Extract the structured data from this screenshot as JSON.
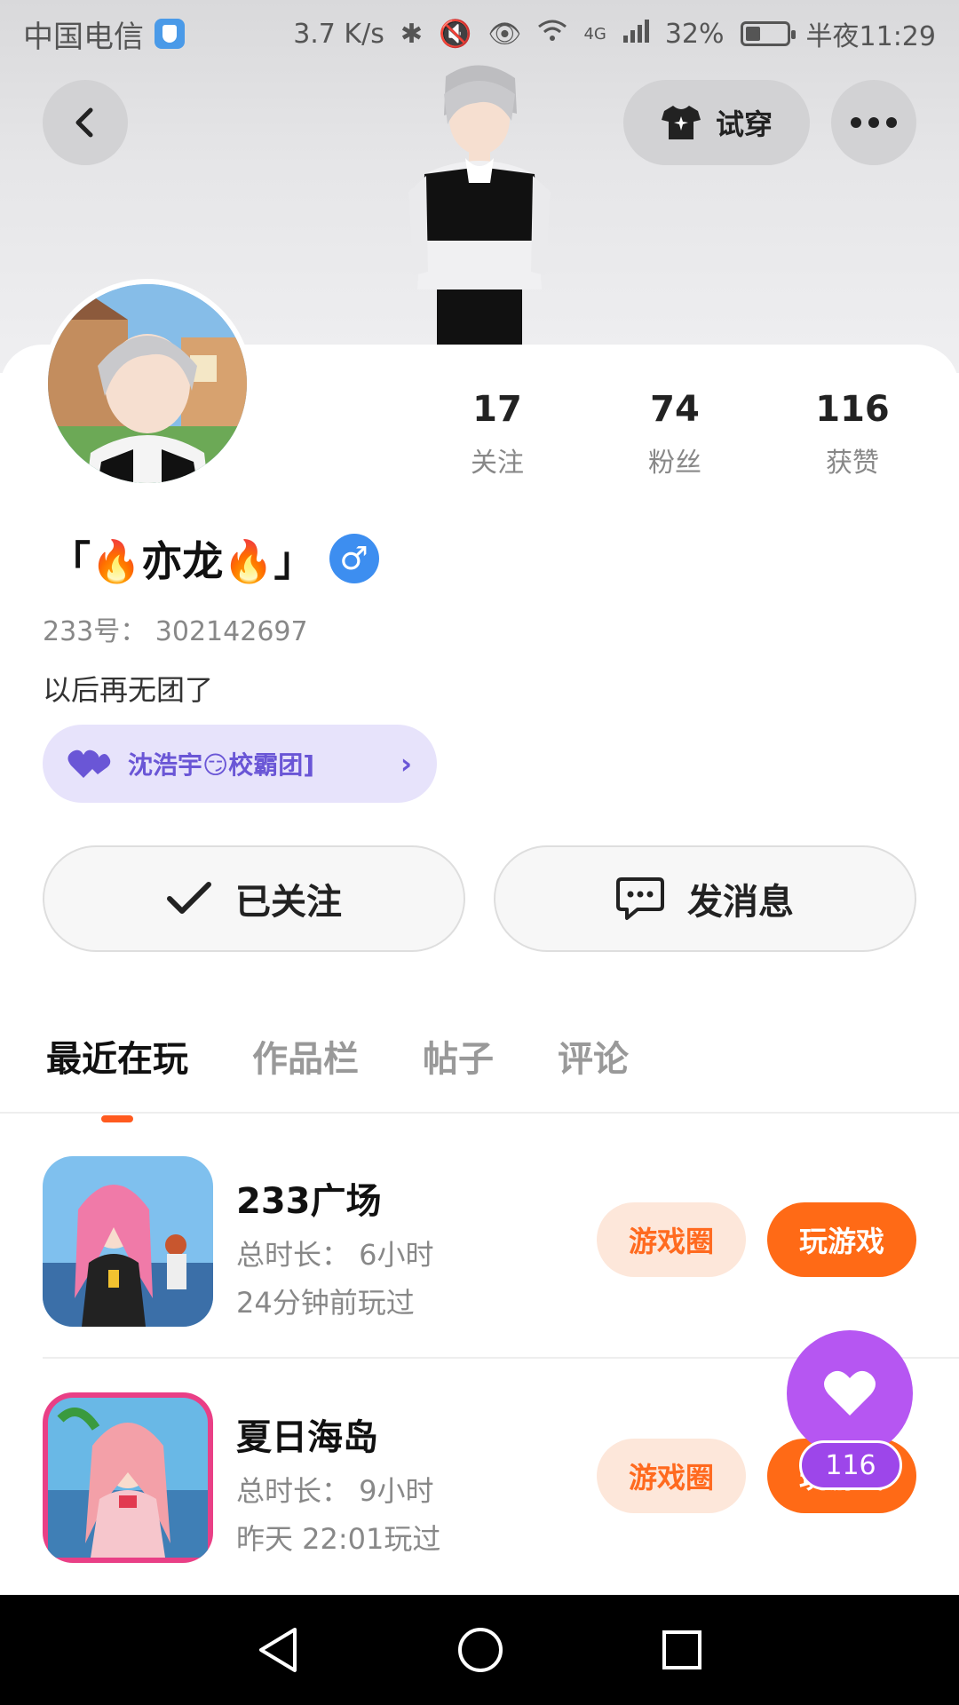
{
  "status_bar": {
    "carrier": "中国电信",
    "speed": "3.7 K/s",
    "network": "4G",
    "battery": "32%",
    "battery_level": 0.32,
    "time": "半夜11:29"
  },
  "header": {
    "try_on_label": "试穿"
  },
  "profile": {
    "nickname": "「🔥亦龙🔥」",
    "gender_symbol": "♂",
    "uid_text": "233号： 302142697",
    "bio": "以后再无团了",
    "club_label": "沈浩宇😏校霸团]"
  },
  "stats": [
    {
      "value": "17",
      "label": "关注"
    },
    {
      "value": "74",
      "label": "粉丝"
    },
    {
      "value": "116",
      "label": "获赞"
    }
  ],
  "actions": {
    "follow_label": "已关注",
    "message_label": "发消息"
  },
  "tabs": [
    {
      "label": "最近在玩",
      "active": true
    },
    {
      "label": "作品栏",
      "active": false
    },
    {
      "label": "帖子",
      "active": false
    },
    {
      "label": "评论",
      "active": false
    }
  ],
  "games": [
    {
      "name": "233广场",
      "playtime": "总时长： 6小时",
      "last_played": "24分钟前玩过",
      "circle_label": "游戏圈",
      "play_label": "玩游戏"
    },
    {
      "name": "夏日海岛",
      "playtime": "总时长： 9小时",
      "last_played": "昨天 22:01玩过",
      "circle_label": "游戏圈",
      "play_label": "玩游戏"
    }
  ],
  "like_fab": {
    "count": "116"
  },
  "colors": {
    "accent": "#ff6a16",
    "club_bg": "#e7e3fb",
    "club_text": "#6a56d6",
    "gender": "#3d8ef0",
    "like": "#b656f2"
  }
}
